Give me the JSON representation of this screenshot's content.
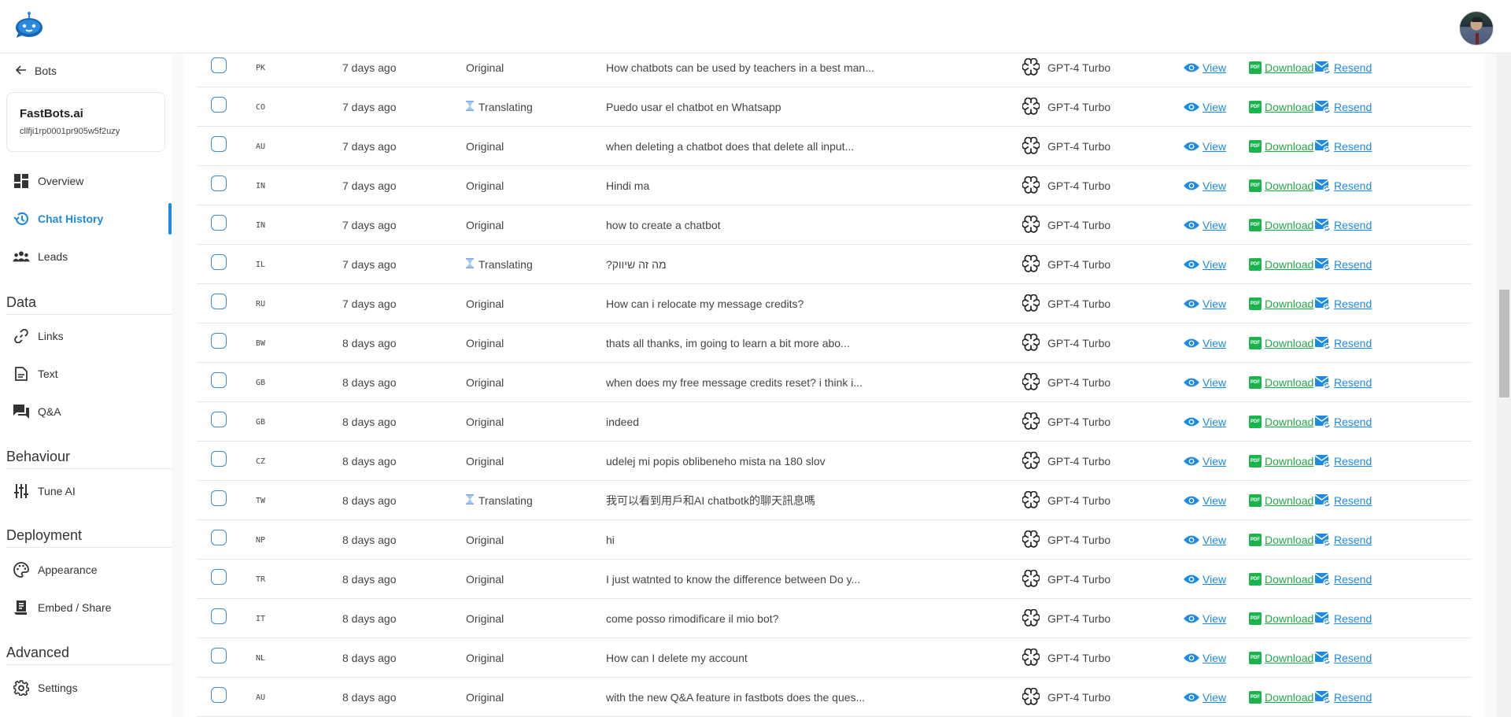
{
  "app": {
    "logo_icon": "robot-logo-icon",
    "avatar_alt": "user-avatar"
  },
  "sidebar": {
    "back_label": "Bots",
    "bot": {
      "name": "FastBots.ai",
      "id": "cllfji1rp0001pr905w5f2uzy"
    },
    "main_items": [
      {
        "label": "Overview",
        "icon": "dashboard-icon",
        "active": false
      },
      {
        "label": "Chat History",
        "icon": "history-icon",
        "active": true
      },
      {
        "label": "Leads",
        "icon": "people-icon",
        "active": false
      }
    ],
    "sections": [
      {
        "title": "Data",
        "items": [
          {
            "label": "Links",
            "icon": "link-icon"
          },
          {
            "label": "Text",
            "icon": "document-icon"
          },
          {
            "label": "Q&A",
            "icon": "chat-bubbles-icon"
          }
        ]
      },
      {
        "title": "Behaviour",
        "items": [
          {
            "label": "Tune AI",
            "icon": "sliders-icon"
          }
        ]
      },
      {
        "title": "Deployment",
        "items": [
          {
            "label": "Appearance",
            "icon": "palette-icon"
          },
          {
            "label": "Embed / Share",
            "icon": "embed-icon"
          }
        ]
      },
      {
        "title": "Advanced",
        "items": [
          {
            "label": "Settings",
            "icon": "gear-icon"
          }
        ]
      }
    ]
  },
  "table": {
    "actions": {
      "view": "View",
      "download": "Download",
      "resend": "Resend"
    },
    "colors": {
      "view": "#1d8ae8",
      "download": "#22a94a",
      "resend": "#1d8ae8",
      "active": "#1d8ae8"
    },
    "rows": [
      {
        "country": "PK",
        "time": "7 days ago",
        "status": "Original",
        "message": "How chatbots can be used by teachers in a best man...",
        "model": "GPT-4 Turbo"
      },
      {
        "country": "CO",
        "time": "7 days ago",
        "status": "Translating",
        "message": "Puedo usar el chatbot en Whatsapp",
        "model": "GPT-4 Turbo"
      },
      {
        "country": "AU",
        "time": "7 days ago",
        "status": "Original",
        "message": "when deleting a chatbot does that delete all input...",
        "model": "GPT-4 Turbo"
      },
      {
        "country": "IN",
        "time": "7 days ago",
        "status": "Original",
        "message": "Hindi ma",
        "model": "GPT-4 Turbo"
      },
      {
        "country": "IN",
        "time": "7 days ago",
        "status": "Original",
        "message": "how to create a chatbot",
        "model": "GPT-4 Turbo"
      },
      {
        "country": "IL",
        "time": "7 days ago",
        "status": "Translating",
        "message": "מה זה שיווק?",
        "model": "GPT-4 Turbo"
      },
      {
        "country": "RU",
        "time": "7 days ago",
        "status": "Original",
        "message": "How can i relocate my message credits?",
        "model": "GPT-4 Turbo"
      },
      {
        "country": "BW",
        "time": "8 days ago",
        "status": "Original",
        "message": "thats all thanks, im going to learn a bit more abo...",
        "model": "GPT-4 Turbo"
      },
      {
        "country": "GB",
        "time": "8 days ago",
        "status": "Original",
        "message": "when does my free message credits reset? i think i...",
        "model": "GPT-4 Turbo"
      },
      {
        "country": "GB",
        "time": "8 days ago",
        "status": "Original",
        "message": "indeed",
        "model": "GPT-4 Turbo"
      },
      {
        "country": "CZ",
        "time": "8 days ago",
        "status": "Original",
        "message": "udelej mi popis oblibeneho mista na 180 slov",
        "model": "GPT-4 Turbo"
      },
      {
        "country": "TW",
        "time": "8 days ago",
        "status": "Translating",
        "message": "我可以看到用戶和AI chatbotk的聊天訊息嗎",
        "model": "GPT-4 Turbo"
      },
      {
        "country": "NP",
        "time": "8 days ago",
        "status": "Original",
        "message": "hi",
        "model": "GPT-4 Turbo"
      },
      {
        "country": "TR",
        "time": "8 days ago",
        "status": "Original",
        "message": "I just watnted to know the difference between Do y...",
        "model": "GPT-4 Turbo"
      },
      {
        "country": "IT",
        "time": "8 days ago",
        "status": "Original",
        "message": "come posso rimodificare il mio bot?",
        "model": "GPT-4 Turbo"
      },
      {
        "country": "NL",
        "time": "8 days ago",
        "status": "Original",
        "message": "How can I delete my account",
        "model": "GPT-4 Turbo"
      },
      {
        "country": "AU",
        "time": "8 days ago",
        "status": "Original",
        "message": "with the new Q&A feature in fastbots does the ques...",
        "model": "GPT-4 Turbo"
      }
    ]
  }
}
